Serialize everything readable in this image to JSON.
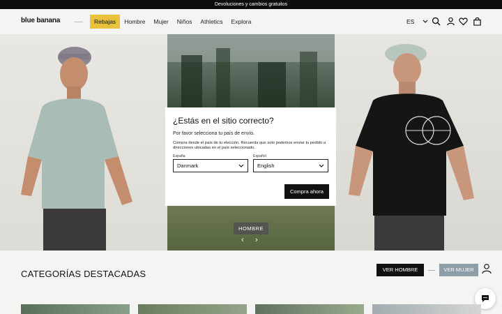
{
  "promo": {
    "text": "Devoluciones y cambios gratuitos"
  },
  "header": {
    "logo": "blue banana",
    "nav": [
      {
        "label": "Rebajas"
      },
      {
        "label": "Hombre"
      },
      {
        "label": "Mujer"
      },
      {
        "label": "Niños"
      },
      {
        "label": "Athletics"
      },
      {
        "label": "Explora"
      }
    ],
    "language": "ES",
    "icons": [
      "search-icon",
      "account-icon",
      "wishlist-icon",
      "cart-icon"
    ]
  },
  "hero": {
    "cta_label": "HOMBRE",
    "prev": "‹",
    "next": "›",
    "tshirt_print": "BLUE BANANA BRAND ALL TERRAIN GARMENTS"
  },
  "modal": {
    "title": "¿Estás en el sitio correcto?",
    "subtitle": "Por favor selecciona tu país de envío.",
    "body": "Compra desde el país de tu elección. Recuerda que solo podemos enviar tu pedido a direcciones ubicadas en el país seleccionado.",
    "country_label": "España",
    "country_value": "Danmark",
    "language_label": "Español",
    "language_value": "English",
    "submit_label": "Compra ahora"
  },
  "categories": {
    "title": "CATEGORÍAS DESTACADAS",
    "btn_men": "VER HOMBRE",
    "btn_women": "VER MUJER"
  },
  "colors": {
    "sale_accent": "#e9c23a",
    "dark": "#111111",
    "women_button": "#8d9ea8"
  }
}
